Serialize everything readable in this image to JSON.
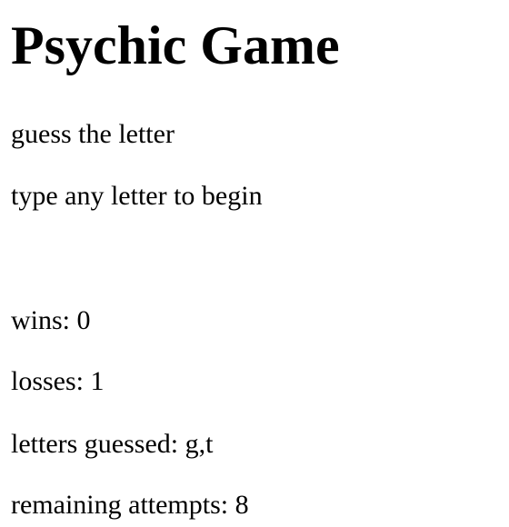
{
  "title": "Psychic Game",
  "instructions": {
    "heading": "guess the letter",
    "prompt": "type any letter to begin"
  },
  "stats": {
    "wins_label": "wins: 0",
    "losses_label": "losses: 1",
    "guessed_label": "letters guessed: g,t",
    "remaining_label": "remaining attempts: 8"
  }
}
